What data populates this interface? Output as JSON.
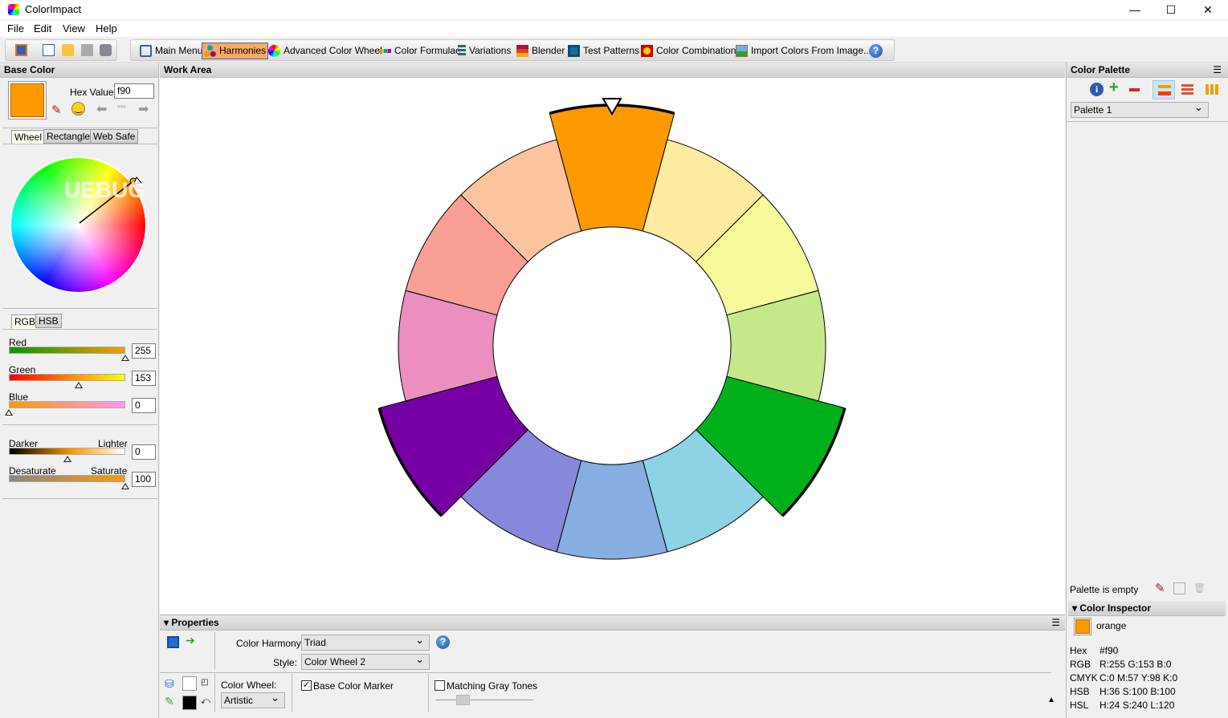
{
  "window": {
    "title": "ColorImpact",
    "minimize": "—",
    "maximize": "☐",
    "close": "✕"
  },
  "menu": [
    "File",
    "Edit",
    "View",
    "Help"
  ],
  "toolbar": {
    "items": [
      {
        "label": "Main Menu",
        "icon": "book-icon"
      },
      {
        "label": "Harmonies",
        "icon": "harmonies-icon",
        "active": true
      },
      {
        "label": "Advanced Color Wheel",
        "icon": "color-wheel-icon"
      },
      {
        "label": "Color Formulae",
        "icon": "color-formulae-icon"
      },
      {
        "label": "Variations",
        "icon": "variations-icon"
      },
      {
        "label": "Blender",
        "icon": "blender-icon"
      },
      {
        "label": "Test Patterns",
        "icon": "test-patterns-icon"
      },
      {
        "label": "Color Combinations",
        "icon": "color-combinations-icon"
      },
      {
        "label": "Import Colors From Image...",
        "icon": "import-image-icon"
      }
    ],
    "help": "?"
  },
  "base_color": {
    "title": "Base Color",
    "hex_label": "Hex Value:",
    "hex_value": "f90",
    "swatch": "#ff9900",
    "tabs": [
      "Wheel",
      "Rectangle",
      "Web Safe"
    ],
    "model_tabs": [
      "RGB",
      "HSB"
    ],
    "sliders": [
      {
        "label": "Red",
        "value": "255",
        "fraction": 1.0
      },
      {
        "label": "Green",
        "value": "153",
        "fraction": 0.6
      },
      {
        "label": "Blue",
        "value": "0",
        "fraction": 0
      }
    ],
    "darker": "Darker",
    "lighter": "Lighter",
    "shade_value": "0",
    "shade_fraction": 0.5,
    "desaturate": "Desaturate",
    "saturate": "Saturate",
    "sat_value": "100",
    "sat_fraction": 1.0,
    "watermark": "UEBUG"
  },
  "work_area": {
    "title": "Work Area",
    "wheel": {
      "segments": [
        "#ff9900",
        "#feeaa0",
        "#f6fa9b",
        "#c6e88b",
        "#00b01a",
        "#8cd3e6",
        "#87aee0",
        "#8787db",
        "#7700a5",
        "#ea8fbf",
        "#f99f95",
        "#fdc49b"
      ],
      "highlighted": [
        0,
        4,
        8
      ],
      "marker_segment": 0
    }
  },
  "properties": {
    "title": "Properties",
    "harmony_label": "Color Harmony:",
    "harmony": "Triad",
    "style_label": "Style:",
    "style": "Color Wheel 2",
    "wheel_label": "Color Wheel:",
    "wheel_value": "Artistic",
    "base_marker": "Base Color Marker",
    "base_marker_checked": true,
    "gray_tones": "Matching Gray Tones",
    "gray_tones_checked": false
  },
  "palette": {
    "title": "Color Palette",
    "selected": "Palette 1",
    "empty_text": "Palette is empty"
  },
  "inspector": {
    "title": "Color Inspector",
    "name": "orange",
    "swatch": "#ff9900",
    "rows": [
      {
        "k": "Hex",
        "v": "#f90"
      },
      {
        "k": "RGB",
        "v": "R:255  G:153  B:0"
      },
      {
        "k": "CMYK",
        "v": "C:0  M:57  Y:98  K:0"
      },
      {
        "k": "HSB",
        "v": "H:36  S:100  B:100"
      },
      {
        "k": "HSL",
        "v": "H:24  S:240  L:120"
      }
    ]
  }
}
